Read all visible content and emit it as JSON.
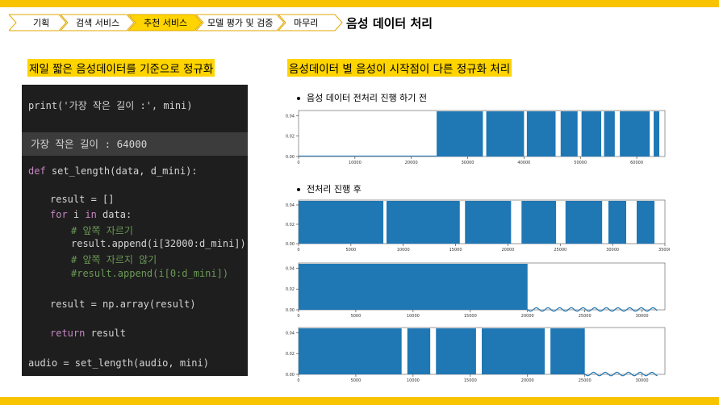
{
  "nav": {
    "items": [
      {
        "label": "기획",
        "active": false
      },
      {
        "label": "검색 서비스",
        "active": false
      },
      {
        "label": "추천 서비스",
        "active": true
      },
      {
        "label": "모델 평가 및 검증",
        "active": false
      },
      {
        "label": "마무리",
        "active": false
      }
    ],
    "active_color": "#ffd400"
  },
  "page_title": "음성 데이터 처리",
  "left_heading": "제일 짧은 음성데이터를 기준으로 정규화",
  "right_heading": "음성데이터 별 음성이 시작점이 다른 정규화 처리",
  "code": {
    "line1": "print('가장 작은 길이 :', mini)",
    "output": "가장 작은 길이 : 64000",
    "def_kw": "def",
    "def_rest": " set_length(data, d_mini):",
    "line_result_init": "result = []",
    "for_kw": "for",
    "for_mid": " i ",
    "in_kw": "in",
    "for_rest": " data:",
    "comment1": "# 앞쪽 자르기",
    "append1": "result.append(i[32000:d_mini])",
    "comment2": "# 앞쪽 자르지 않기",
    "comment3": "#result.append(i[0:d_mini])",
    "result_np": "result = np.array(result)",
    "return_kw": "return",
    "return_rest": " result",
    "last": "audio = set_length(audio, mini)"
  },
  "bullets": {
    "before": "음성 데이터 전처리 진행 하기 전",
    "after": "전처리 진행 후"
  },
  "chart_data": [
    {
      "type": "area",
      "title": "",
      "xlim": [
        0,
        65000
      ],
      "ylim": [
        0,
        0.045
      ],
      "x_ticks": [
        0,
        10000,
        20000,
        30000,
        40000,
        50000,
        60000
      ],
      "y_ticks": [
        "0.00",
        "0.02",
        "0.04"
      ],
      "segments": [
        [
          24500,
          32700
        ],
        [
          33300,
          40000
        ],
        [
          40500,
          45600
        ],
        [
          46500,
          49500
        ],
        [
          50200,
          53700
        ],
        [
          54200,
          56100
        ],
        [
          57000,
          62300
        ],
        [
          63000,
          64000
        ]
      ],
      "color": "#1f77b4"
    },
    {
      "type": "area",
      "title": "",
      "xlim": [
        0,
        35000
      ],
      "ylim": [
        0,
        0.045
      ],
      "x_ticks": [
        0,
        5000,
        10000,
        15000,
        20000,
        25000,
        30000,
        35000
      ],
      "y_ticks": [
        "0.00",
        "0.02",
        "0.04"
      ],
      "segments": [
        [
          0,
          8100
        ],
        [
          8400,
          15400
        ],
        [
          15900,
          20300
        ],
        [
          21300,
          24600
        ],
        [
          25500,
          29000
        ],
        [
          29600,
          31300
        ],
        [
          32300,
          34000
        ]
      ],
      "color": "#1f77b4"
    },
    {
      "type": "area",
      "title": "",
      "xlim": [
        0,
        32000
      ],
      "ylim": [
        0,
        0.045
      ],
      "x_ticks": [
        0,
        5000,
        10000,
        15000,
        20000,
        25000,
        30000
      ],
      "y_ticks": [
        "0.00",
        "0.02",
        "0.04"
      ],
      "segments": [
        [
          0,
          20000
        ]
      ],
      "tail_from": 20000,
      "color": "#1f77b4"
    },
    {
      "type": "area",
      "title": "",
      "xlim": [
        0,
        32000
      ],
      "ylim": [
        0,
        0.045
      ],
      "x_ticks": [
        0,
        5000,
        10000,
        15000,
        20000,
        25000,
        30000
      ],
      "y_ticks": [
        "0.00",
        "0.02",
        "0.04"
      ],
      "segments": [
        [
          0,
          9000
        ],
        [
          9500,
          11500
        ],
        [
          12000,
          15500
        ],
        [
          16000,
          21500
        ],
        [
          22000,
          25000
        ]
      ],
      "tail_from": 25000,
      "color": "#1f77b4"
    }
  ]
}
